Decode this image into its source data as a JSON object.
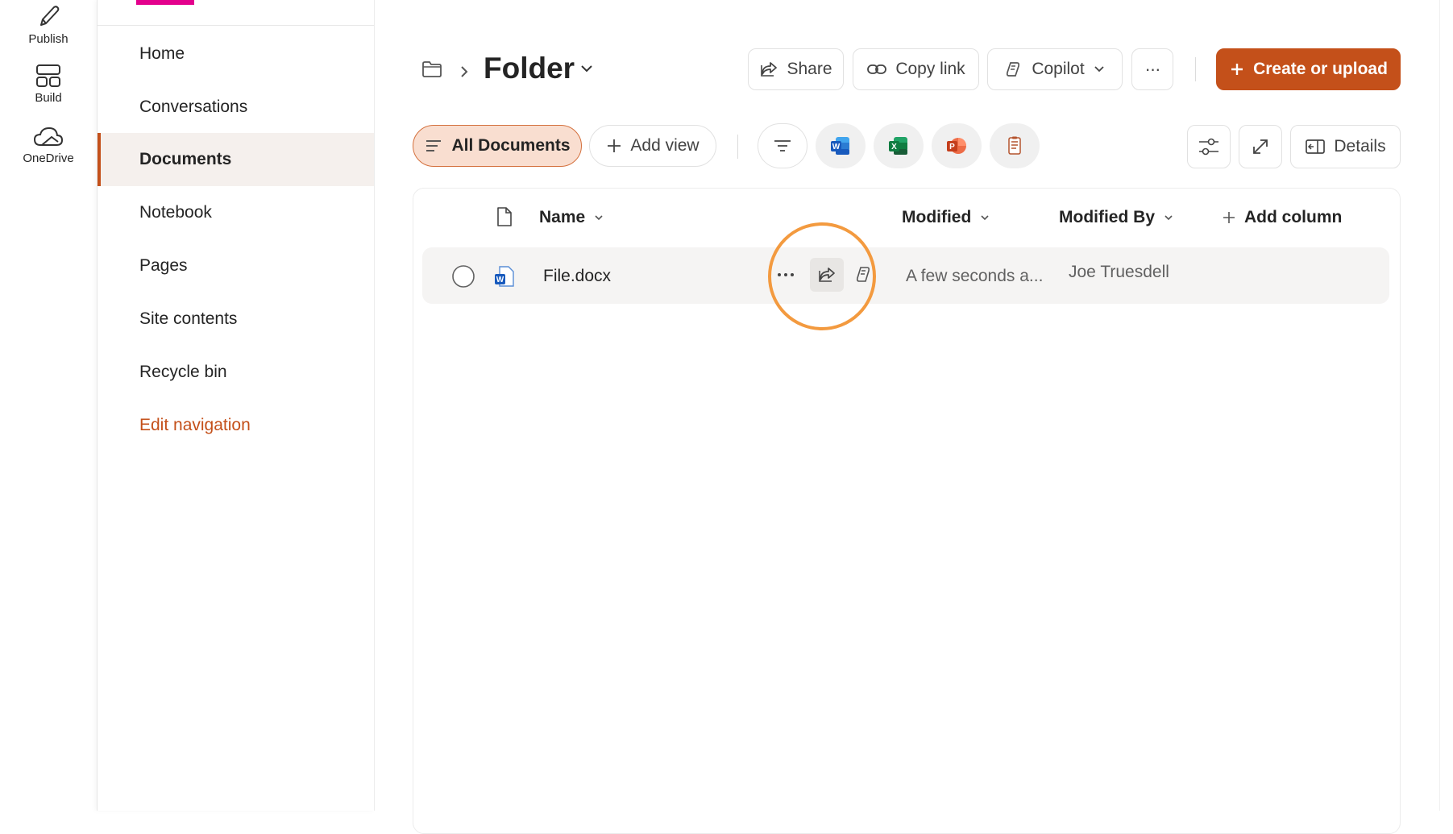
{
  "rail": {
    "publish": "Publish",
    "build": "Build",
    "onedrive": "OneDrive"
  },
  "nav": {
    "items": [
      {
        "label": "Home"
      },
      {
        "label": "Conversations"
      },
      {
        "label": "Documents",
        "active": true
      },
      {
        "label": "Notebook"
      },
      {
        "label": "Pages"
      },
      {
        "label": "Site contents"
      },
      {
        "label": "Recycle bin"
      }
    ],
    "edit": "Edit navigation"
  },
  "header": {
    "title": "Folder",
    "share": "Share",
    "copy_link": "Copy link",
    "copilot": "Copilot",
    "more": "···",
    "create": "Create or upload"
  },
  "toolbar": {
    "all_documents": "All Documents",
    "add_view": "Add view",
    "details": "Details"
  },
  "columns": {
    "name": "Name",
    "modified": "Modified",
    "modified_by": "Modified By",
    "add_column": "Add column"
  },
  "files": [
    {
      "name": "File.docx",
      "modified": "A few seconds a...",
      "modified_by": "Joe Truesdell"
    }
  ],
  "colors": {
    "accent": "#c4501a",
    "accent_soft": "#f9ded0",
    "rail_accent": "#e3008c",
    "highlight": "#f39a3f"
  }
}
